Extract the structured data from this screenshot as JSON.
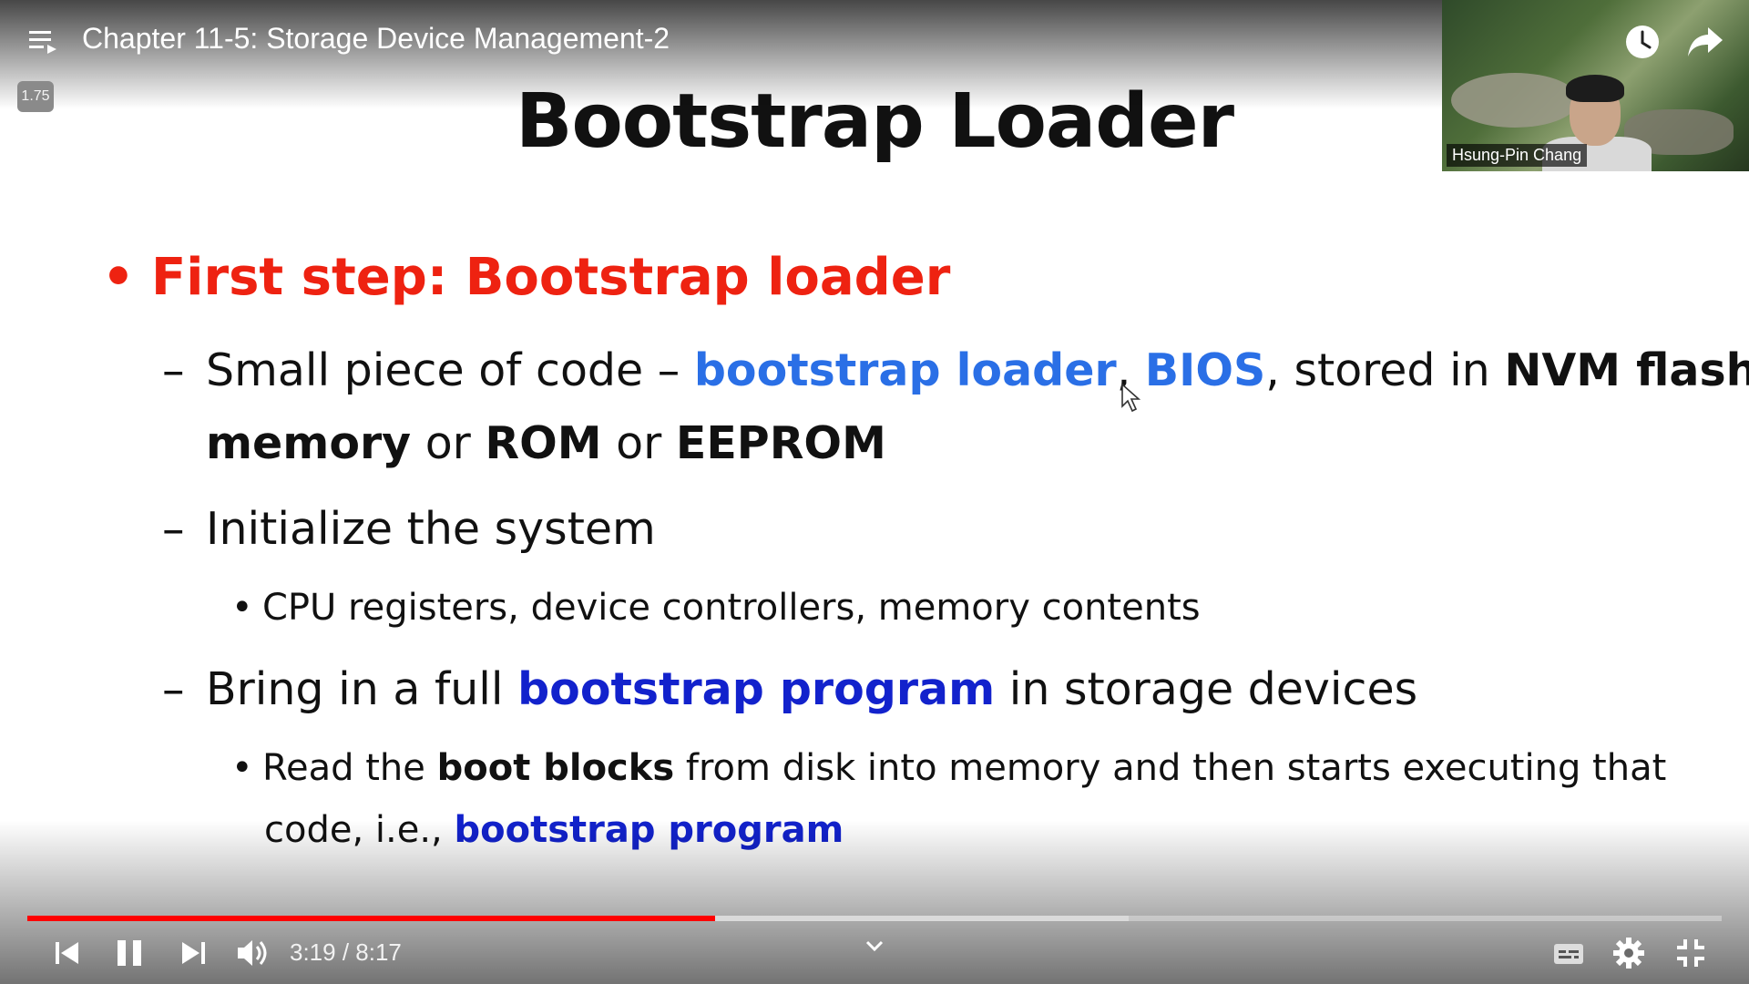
{
  "header": {
    "video_title": "Chapter 11-5: Storage Device Management-2",
    "playback_speed": "1.75"
  },
  "webcam": {
    "presenter_name": "Hsung-Pin Chang"
  },
  "slide": {
    "title": "Bootstrap Loader",
    "bullet1": "First step: Bootstrap loader",
    "item1": {
      "t1": "Small piece of code – ",
      "t2": "bootstrap loader",
      "t3": ", ",
      "t4": "BIOS",
      "t5": ", stored in ",
      "t6": "NVM flash",
      "t7": "memory",
      "t8": " or ",
      "t9": "ROM",
      "t10": " or ",
      "t11": "EEPROM"
    },
    "item2": "Initialize the system",
    "item2_sub": "CPU registers, device controllers, memory contents",
    "item3": {
      "t1": "Bring in a full ",
      "t2": "bootstrap program",
      "t3": " in storage devices"
    },
    "item3_sub": {
      "t1": "Read the ",
      "t2": "boot blocks",
      "t3": " from disk into memory and then starts executing that",
      "t4": "code, i.e., ",
      "t5": "bootstrap program"
    }
  },
  "player": {
    "time_display": "3:19 / 8:17",
    "played_fraction": 0.406,
    "buffered_fraction": 0.65,
    "accent_color": "#ff0000"
  },
  "icons": [
    "playlist-icon",
    "clock-icon",
    "share-icon",
    "prev-icon",
    "pause-icon",
    "next-icon",
    "volume-icon",
    "chevron-down-icon",
    "captions-icon",
    "gear-icon",
    "exit-fullscreen-icon"
  ]
}
